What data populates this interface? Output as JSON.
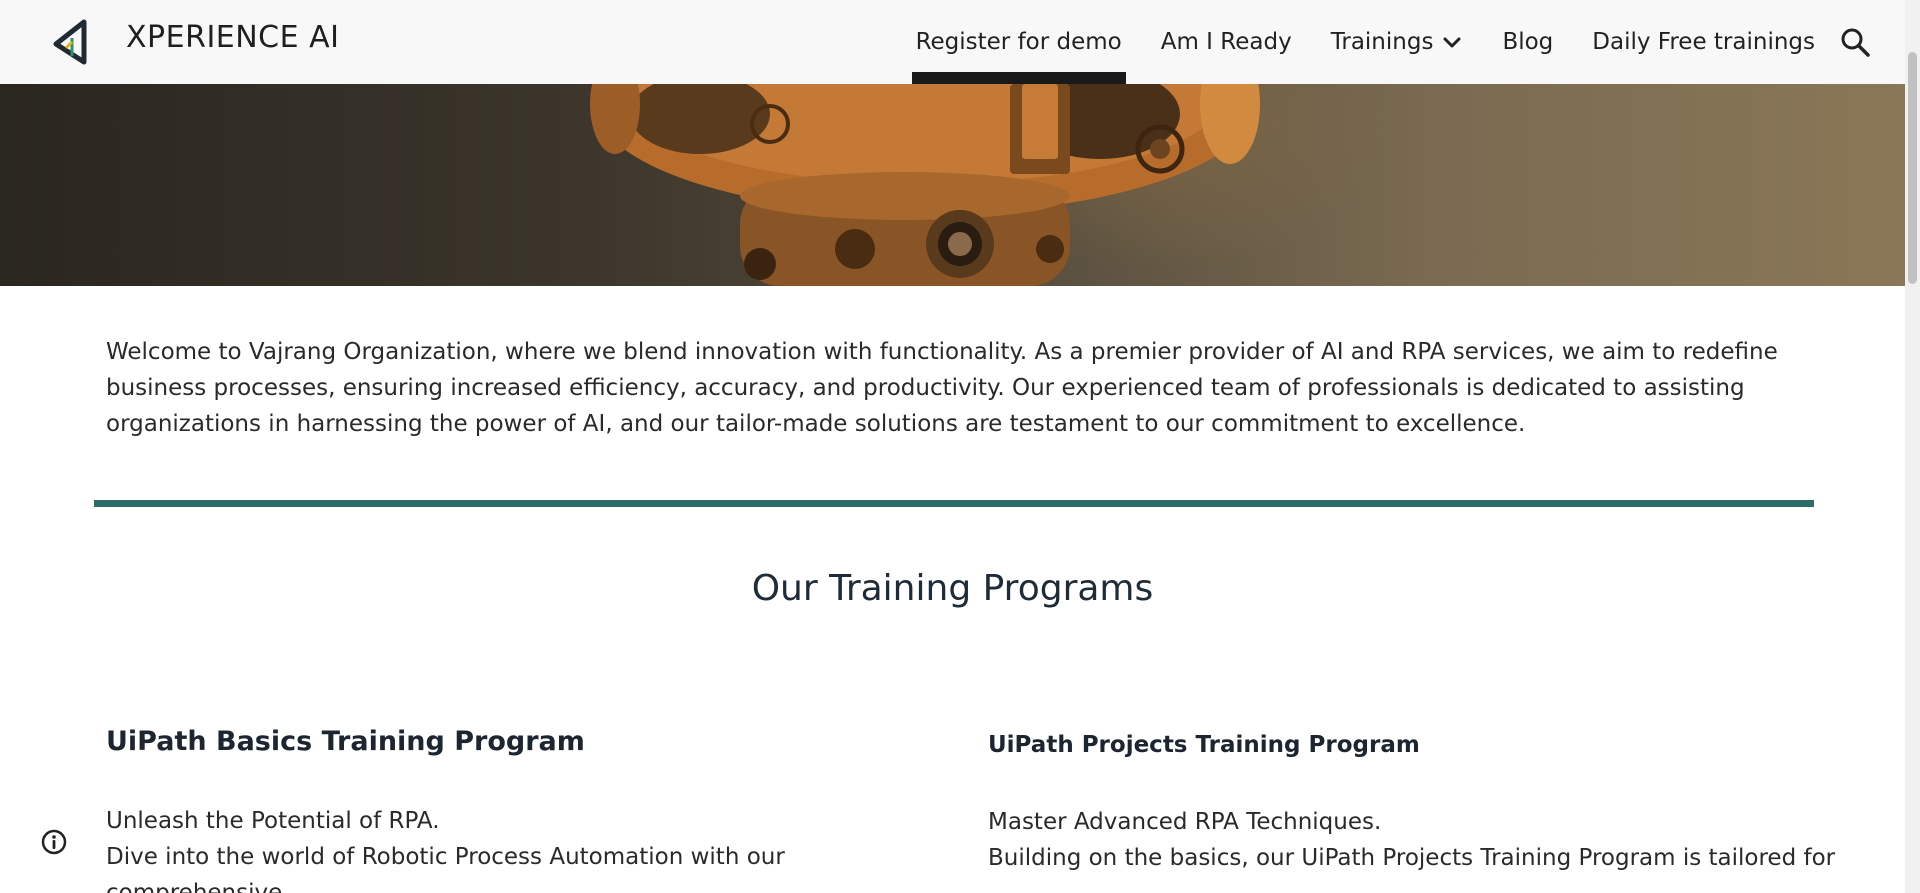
{
  "header": {
    "site_title": "XPERIENCE AI",
    "nav": [
      {
        "label": "Register for demo",
        "active": true
      },
      {
        "label": "Am I Ready"
      },
      {
        "label": "Trainings",
        "has_dropdown": true
      },
      {
        "label": "Blog"
      },
      {
        "label": "Daily Free trainings"
      }
    ]
  },
  "intro": {
    "text": "Welcome to Vajrang Organization, where we blend innovation with functionality. As a premier provider of AI and RPA services, we aim to redefine business processes, ensuring increased efficiency, accuracy, and productivity. Our experienced team of professionals is dedicated to assisting organizations in harnessing the power of AI, and our tailor-made solutions are testament to our commitment to excellence."
  },
  "section": {
    "title": "Our Training Programs"
  },
  "programs": [
    {
      "title": "UiPath Basics Training Program",
      "tagline": "Unleash the Potential of RPA.",
      "desc": "Dive into the world of Robotic Process Automation with our comprehensive"
    },
    {
      "title": "UiPath Projects Training Program",
      "tagline": "Master Advanced RPA Techniques.",
      "desc": "Building on the basics, our UiPath Projects Training Program is tailored for"
    }
  ],
  "colors": {
    "header_bg": "#f8f8f8",
    "divider": "#2e6b6b",
    "active_indicator": "#1a1a1a"
  },
  "icons": {
    "logo": "triangle-logo-icon",
    "search": "search-icon",
    "dropdown": "chevron-down-icon",
    "info": "info-icon"
  }
}
